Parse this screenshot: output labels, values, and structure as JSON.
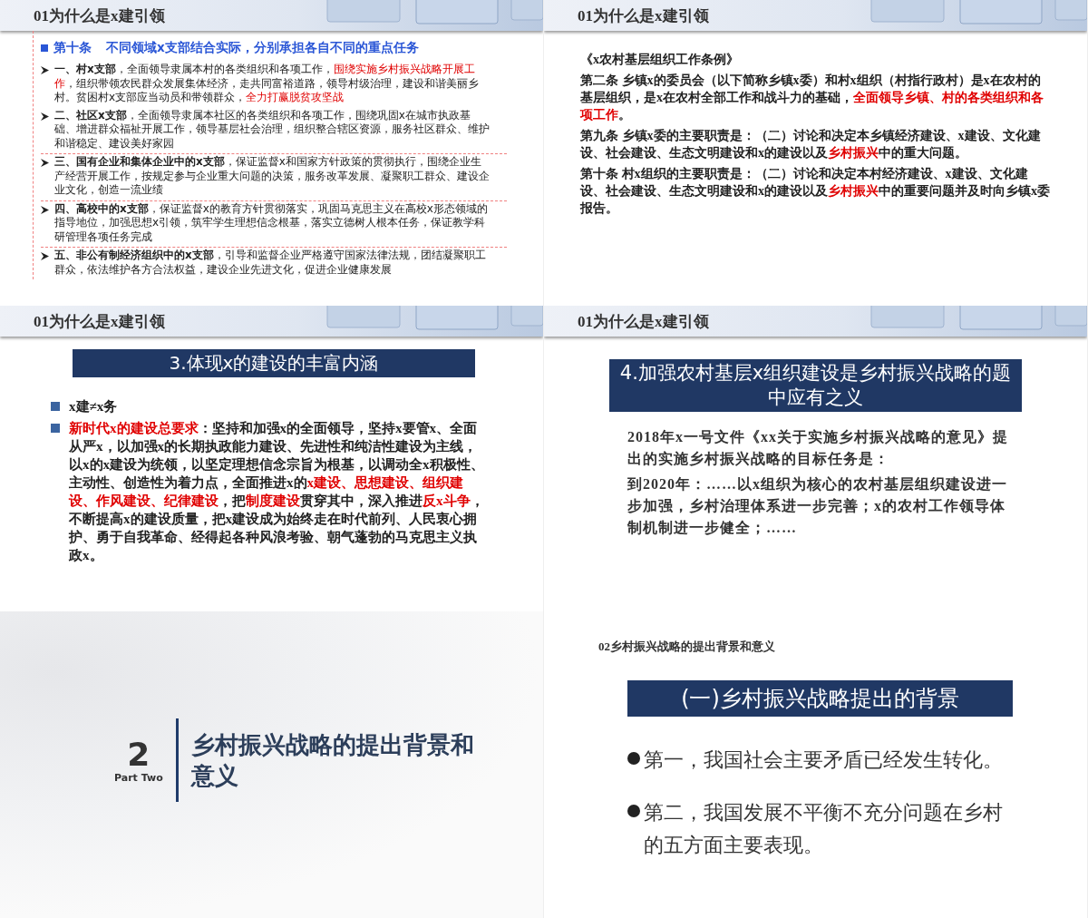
{
  "slides": [
    {
      "kind": "articles",
      "header": "01为什么是x建引领",
      "heading": {
        "label": "第十条",
        "text": "不同领域x支部结合实际，分别承担各自不同的重点任务"
      },
      "items": [
        {
          "segments": [
            {
              "kind": "bold",
              "text": "一、村x支部"
            },
            {
              "kind": "plain",
              "text": "，全面领导隶属本村的各类组织和各项工作，"
            },
            {
              "kind": "red",
              "text": "围绕实施乡村振兴战略开展工作"
            },
            {
              "kind": "plain",
              "text": "，组织带领农民群众发展集体经济，走共同富裕道路，领导村级治理，建设和谐美丽乡村。贫困村x支部应当动员和带领群众，"
            },
            {
              "kind": "red",
              "text": "全力打赢脱贫攻坚战"
            }
          ]
        },
        {
          "segments": [
            {
              "kind": "bold",
              "text": "二、社区x支部"
            },
            {
              "kind": "plain",
              "text": "，全面领导隶属本社区的各类组织和各项工作，围绕巩固x在城市执政基础、增进群众福祉开展工作，领导基层社会治理，组织整合辖区资源，服务社区群众、维护和谐稳定、建设美好家园"
            }
          ]
        },
        {
          "segments": [
            {
              "kind": "bold",
              "text": "三、国有企业和集体企业中的x支部"
            },
            {
              "kind": "plain",
              "text": "，保证监督x和国家方针政策的贯彻执行，围绕企业生产经营开展工作，按规定参与企业重大问题的决策，服务改革发展、凝聚职工群众、建设企业文化，创造一流业绩"
            }
          ]
        },
        {
          "segments": [
            {
              "kind": "bold",
              "text": "四、高校中的x支部"
            },
            {
              "kind": "plain",
              "text": "，保证监督x的教育方针贯彻落实，巩固马克思主义在高校x形态领域的指导地位，加强思想x引领，筑牢学生理想信念根基，落实立德树人根本任务，保证教学科研管理各项任务完成"
            }
          ]
        },
        {
          "segments": [
            {
              "kind": "bold",
              "text": "五、非公有制经济组织中的x支部"
            },
            {
              "kind": "plain",
              "text": "，引导和监督企业严格遵守国家法律法规，团结凝聚职工群众，依法维护各方合法权益，建设企业先进文化，促进企业健康发展"
            }
          ]
        }
      ]
    },
    {
      "kind": "regulation",
      "header": "01为什么是x建引领",
      "paragraphs": [
        {
          "segments": [
            {
              "kind": "plain",
              "text": "《x农村基层组织工作条例》"
            }
          ]
        },
        {
          "segments": [
            {
              "kind": "plain",
              "text": "第二条 乡镇x的委员会（以下简称乡镇x委）和村x组织（村指行政村）是x在农村的基层组织，是x在农村全部工作和战斗力的基础，"
            },
            {
              "kind": "red",
              "text": "全面领导乡镇、村的各类组织和各项工作"
            },
            {
              "kind": "plain",
              "text": "。"
            }
          ]
        },
        {
          "segments": [
            {
              "kind": "plain",
              "text": "第九条 乡镇x委的主要职责是：（二）讨论和决定本乡镇经济建设、x建设、文化建设、社会建设、生态文明建设和x的建设以及"
            },
            {
              "kind": "red",
              "text": "乡村振兴"
            },
            {
              "kind": "plain",
              "text": "中的重大问题。"
            }
          ]
        },
        {
          "segments": [
            {
              "kind": "plain",
              "text": "第十条 村x组织的主要职责是：（二）讨论和决定本村经济建设、x建设、文化建设、社会建设、生态文明建设和x的建设以及"
            },
            {
              "kind": "red",
              "text": "乡村振兴"
            },
            {
              "kind": "plain",
              "text": "中的重要问题并及时向乡镇x委报告。"
            }
          ]
        }
      ]
    },
    {
      "kind": "bullets",
      "header": "01为什么是x建引领",
      "title": "3.体现x的建设的丰富内涵",
      "paragraphs": [
        {
          "segments": [
            {
              "kind": "plain",
              "text": "x建≠x务"
            }
          ]
        },
        {
          "segments": [
            {
              "kind": "red",
              "text": "新时代x的建设总要求"
            },
            {
              "kind": "plain",
              "text": "：坚持和加强x的全面领导，坚持x要管x、全面从严x，以加强x的长期执政能力建设、先进性和纯洁性建设为主线，以x的x建设为统领，以坚定理想信念宗旨为根基，以调动全x积极性、主动性、创造性为着力点，全面推进x的"
            },
            {
              "kind": "red",
              "text": "x建设、思想建设、组织建设、作风建设、纪律建设"
            },
            {
              "kind": "plain",
              "text": "，把"
            },
            {
              "kind": "red",
              "text": "制度建设"
            },
            {
              "kind": "plain",
              "text": "贯穿其中，深入推进"
            },
            {
              "kind": "red",
              "text": "反x斗争"
            },
            {
              "kind": "plain",
              "text": "，不断提高x的建设质量，把x建设成为始终走在时代前列、人民衷心拥护、勇于自我革命、经得起各种风浪考验、朝气蓬勃的马克思主义执政x。"
            }
          ]
        }
      ]
    },
    {
      "kind": "quote",
      "header": "01为什么是x建引领",
      "title": "4.加强农村基层x组织建设是乡村振兴战略的题中应有之义",
      "paragraphs": [
        {
          "segments": [
            {
              "kind": "plain",
              "text": "2018年x一号文件《xx关于实施乡村振兴战略的意见》提出的实施乡村振兴战略的目标任务是："
            }
          ]
        },
        {
          "segments": [
            {
              "kind": "plain",
              "text": "到2020年：……以x组织为核心的农村基层组织建设进一步加强，乡村治理体系进一步完善；x的农村工作领导体制机制进一步健全；……"
            }
          ]
        }
      ]
    },
    {
      "kind": "section",
      "number": "2",
      "subtitle": "Part Two",
      "title": "乡村振兴战略的提出背景和意义"
    },
    {
      "kind": "points",
      "caption": "02乡村振兴战略的提出背景和意义",
      "title": "(一)乡村振兴战略提出的背景",
      "points": [
        "第一，我国社会主要矛盾已经发生转化。",
        "第二，我国发展不平衡不充分问题在乡村的五方面主要表现。"
      ]
    }
  ]
}
